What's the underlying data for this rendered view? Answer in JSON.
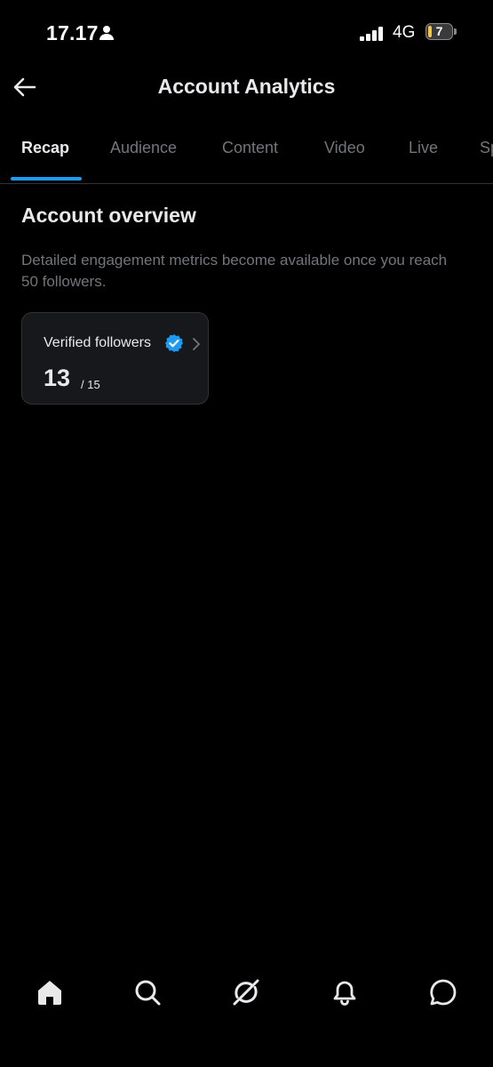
{
  "status_bar": {
    "time": "17.17",
    "network": "4G",
    "battery_level": "7"
  },
  "header": {
    "title": "Account Analytics"
  },
  "tabs": [
    {
      "label": "Recap",
      "active": true
    },
    {
      "label": "Audience",
      "active": false
    },
    {
      "label": "Content",
      "active": false
    },
    {
      "label": "Video",
      "active": false
    },
    {
      "label": "Live",
      "active": false
    },
    {
      "label": "Sp",
      "active": false
    }
  ],
  "overview": {
    "title": "Account overview",
    "description": "Detailed engagement metrics become available once you reach 50 followers.",
    "card": {
      "label": "Verified followers",
      "value": "13",
      "total": "/ 15"
    }
  },
  "bottom_nav": [
    {
      "name": "home-icon"
    },
    {
      "name": "search-icon"
    },
    {
      "name": "grok-icon"
    },
    {
      "name": "notifications-icon"
    },
    {
      "name": "messages-icon"
    }
  ],
  "colors": {
    "accent": "#1d9bf0",
    "background": "#000000",
    "card": "#16181c",
    "muted_text": "#71767b"
  }
}
